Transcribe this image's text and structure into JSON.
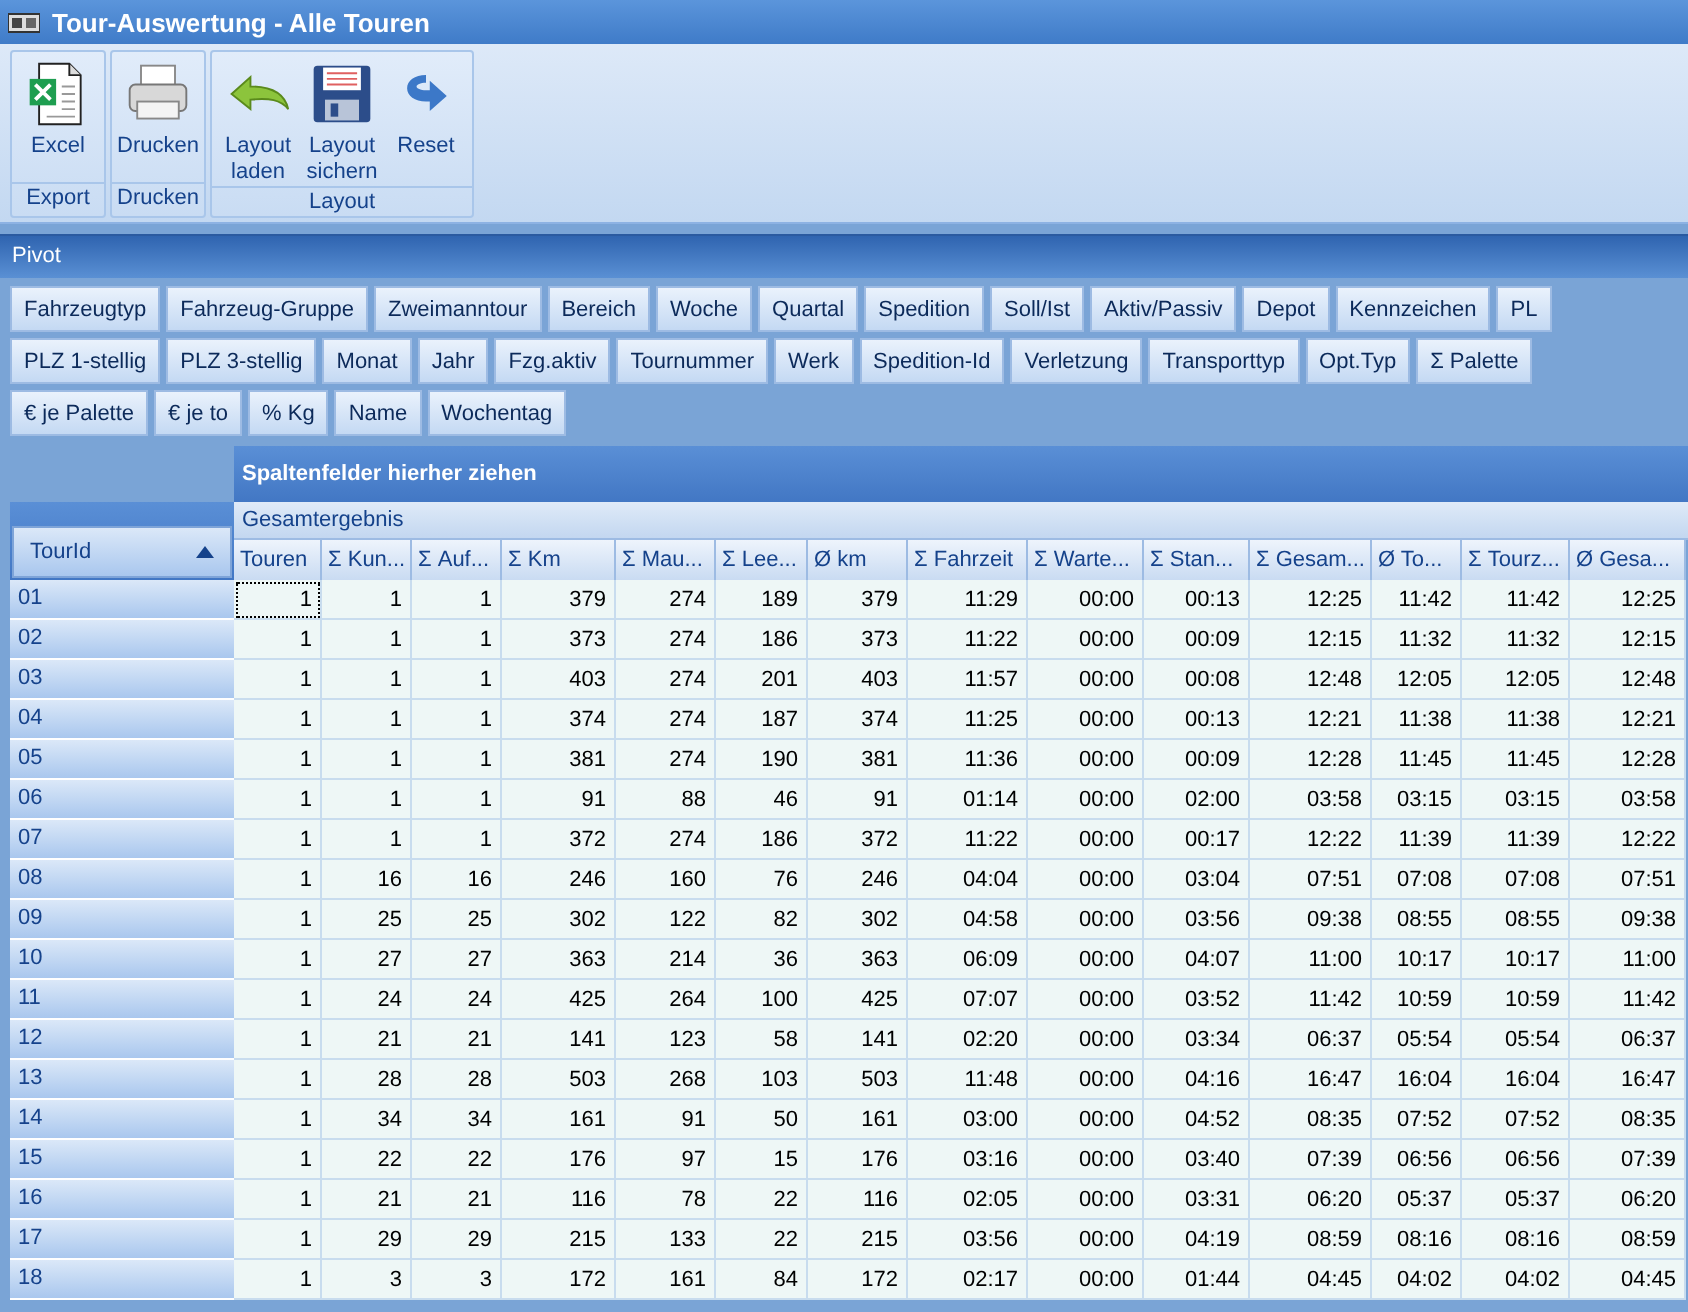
{
  "window": {
    "title": "Tour-Auswertung - Alle Touren"
  },
  "ribbon": {
    "groups": [
      {
        "label": "Export",
        "buttons": [
          {
            "label": "Excel",
            "kind": "excel"
          }
        ]
      },
      {
        "label": "Drucken",
        "buttons": [
          {
            "label": "Drucken",
            "kind": "print"
          }
        ]
      },
      {
        "label": "Layout",
        "buttons": [
          {
            "label": "Layout laden",
            "kind": "undo"
          },
          {
            "label": "Layout sichern",
            "kind": "save"
          },
          {
            "label": "Reset",
            "kind": "redo"
          }
        ]
      }
    ]
  },
  "pivot": {
    "title": "Pivot",
    "field_rows": [
      [
        "Fahrzeugtyp",
        "Fahrzeug-Gruppe",
        "Zweimanntour",
        "Bereich",
        "Woche",
        "Quartal",
        "Spedition",
        "Soll/Ist",
        "Aktiv/Passiv",
        "Depot",
        "Kennzeichen",
        "PL"
      ],
      [
        "PLZ 1-stellig",
        "PLZ 3-stellig",
        "Monat",
        "Jahr",
        "Fzg.aktiv",
        "Tournummer",
        "Werk",
        "Spedition-Id",
        "Verletzung",
        "Transporttyp",
        "Opt.Typ",
        "Σ Palette"
      ],
      [
        "€ je Palette",
        "€ je to",
        "% Kg",
        "Name",
        "Wochentag"
      ]
    ],
    "column_area_hint": "Spaltenfelder hierher ziehen",
    "grand_total": "Gesamtergebnis",
    "row_field": {
      "label": "TourId",
      "sort_ascending": true
    },
    "columns": [
      "Touren",
      "Σ Kun...",
      "Σ Auf...",
      "Σ Km",
      "Σ Mau...",
      "Σ Lee...",
      "Ø km",
      "Σ Fahrzeit",
      "Σ Warte...",
      "Σ Stan...",
      "Σ Gesam...",
      "Ø To...",
      "Σ Tourz...",
      "Ø Gesa..."
    ],
    "rows": [
      {
        "id": "01",
        "cells": [
          "1",
          "1",
          "1",
          "379",
          "274",
          "189",
          "379",
          "11:29",
          "00:00",
          "00:13",
          "12:25",
          "11:42",
          "11:42",
          "12:25"
        ]
      },
      {
        "id": "02",
        "cells": [
          "1",
          "1",
          "1",
          "373",
          "274",
          "186",
          "373",
          "11:22",
          "00:00",
          "00:09",
          "12:15",
          "11:32",
          "11:32",
          "12:15"
        ]
      },
      {
        "id": "03",
        "cells": [
          "1",
          "1",
          "1",
          "403",
          "274",
          "201",
          "403",
          "11:57",
          "00:00",
          "00:08",
          "12:48",
          "12:05",
          "12:05",
          "12:48"
        ]
      },
      {
        "id": "04",
        "cells": [
          "1",
          "1",
          "1",
          "374",
          "274",
          "187",
          "374",
          "11:25",
          "00:00",
          "00:13",
          "12:21",
          "11:38",
          "11:38",
          "12:21"
        ]
      },
      {
        "id": "05",
        "cells": [
          "1",
          "1",
          "1",
          "381",
          "274",
          "190",
          "381",
          "11:36",
          "00:00",
          "00:09",
          "12:28",
          "11:45",
          "11:45",
          "12:28"
        ]
      },
      {
        "id": "06",
        "cells": [
          "1",
          "1",
          "1",
          "91",
          "88",
          "46",
          "91",
          "01:14",
          "00:00",
          "02:00",
          "03:58",
          "03:15",
          "03:15",
          "03:58"
        ]
      },
      {
        "id": "07",
        "cells": [
          "1",
          "1",
          "1",
          "372",
          "274",
          "186",
          "372",
          "11:22",
          "00:00",
          "00:17",
          "12:22",
          "11:39",
          "11:39",
          "12:22"
        ]
      },
      {
        "id": "08",
        "cells": [
          "1",
          "16",
          "16",
          "246",
          "160",
          "76",
          "246",
          "04:04",
          "00:00",
          "03:04",
          "07:51",
          "07:08",
          "07:08",
          "07:51"
        ]
      },
      {
        "id": "09",
        "cells": [
          "1",
          "25",
          "25",
          "302",
          "122",
          "82",
          "302",
          "04:58",
          "00:00",
          "03:56",
          "09:38",
          "08:55",
          "08:55",
          "09:38"
        ]
      },
      {
        "id": "10",
        "cells": [
          "1",
          "27",
          "27",
          "363",
          "214",
          "36",
          "363",
          "06:09",
          "00:00",
          "04:07",
          "11:00",
          "10:17",
          "10:17",
          "11:00"
        ]
      },
      {
        "id": "11",
        "cells": [
          "1",
          "24",
          "24",
          "425",
          "264",
          "100",
          "425",
          "07:07",
          "00:00",
          "03:52",
          "11:42",
          "10:59",
          "10:59",
          "11:42"
        ]
      },
      {
        "id": "12",
        "cells": [
          "1",
          "21",
          "21",
          "141",
          "123",
          "58",
          "141",
          "02:20",
          "00:00",
          "03:34",
          "06:37",
          "05:54",
          "05:54",
          "06:37"
        ]
      },
      {
        "id": "13",
        "cells": [
          "1",
          "28",
          "28",
          "503",
          "268",
          "103",
          "503",
          "11:48",
          "00:00",
          "04:16",
          "16:47",
          "16:04",
          "16:04",
          "16:47"
        ]
      },
      {
        "id": "14",
        "cells": [
          "1",
          "34",
          "34",
          "161",
          "91",
          "50",
          "161",
          "03:00",
          "00:00",
          "04:52",
          "08:35",
          "07:52",
          "07:52",
          "08:35"
        ]
      },
      {
        "id": "15",
        "cells": [
          "1",
          "22",
          "22",
          "176",
          "97",
          "15",
          "176",
          "03:16",
          "00:00",
          "03:40",
          "07:39",
          "06:56",
          "06:56",
          "07:39"
        ]
      },
      {
        "id": "16",
        "cells": [
          "1",
          "21",
          "21",
          "116",
          "78",
          "22",
          "116",
          "02:05",
          "00:00",
          "03:31",
          "06:20",
          "05:37",
          "05:37",
          "06:20"
        ]
      },
      {
        "id": "17",
        "cells": [
          "1",
          "29",
          "29",
          "215",
          "133",
          "22",
          "215",
          "03:56",
          "00:00",
          "04:19",
          "08:59",
          "08:16",
          "08:16",
          "08:59"
        ]
      },
      {
        "id": "18",
        "cells": [
          "1",
          "3",
          "3",
          "172",
          "161",
          "84",
          "172",
          "02:17",
          "00:00",
          "01:44",
          "04:45",
          "04:02",
          "04:02",
          "04:45"
        ]
      }
    ]
  }
}
